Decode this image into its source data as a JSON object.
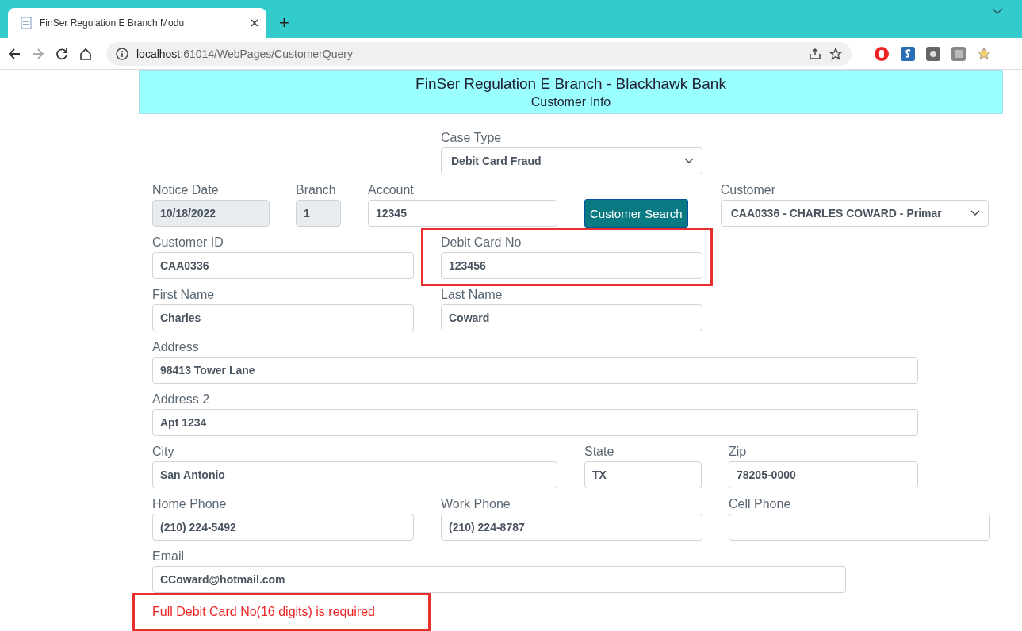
{
  "browser": {
    "tab_title": "FinSer Regulation E Branch Modu",
    "new_tab": "+",
    "url_host": "localhost",
    "url_path": ":61014/WebPages/CustomerQuery"
  },
  "header": {
    "title": "FinSer Regulation E Branch - Blackhawk Bank",
    "subtitle": "Customer Info"
  },
  "form": {
    "fields": [
      {
        "kind": "select",
        "label": "Case Type",
        "value": "Debit Card Fraud"
      },
      {
        "kind": "input",
        "label": "Notice Date",
        "value": "10/18/2022",
        "disabled": true
      },
      {
        "kind": "input",
        "label": "Branch",
        "value": "1",
        "disabled": true
      },
      {
        "kind": "input",
        "label": "Account",
        "value": "12345",
        "disabled": false
      },
      {
        "kind": "button",
        "label": "Customer Search"
      },
      {
        "kind": "select",
        "label": "Customer",
        "value": "CAA0336 - CHARLES COWARD - Primar"
      },
      {
        "kind": "input",
        "label": "Customer ID",
        "value": "CAA0336",
        "disabled": false
      },
      {
        "kind": "input",
        "label": "Debit Card No",
        "value": "123456",
        "disabled": false,
        "highlighted": true
      },
      {
        "kind": "input",
        "label": "First Name",
        "value": "Charles",
        "disabled": false
      },
      {
        "kind": "input",
        "label": "Last Name",
        "value": "Coward",
        "disabled": false
      },
      {
        "kind": "input",
        "label": "Address",
        "value": "98413 Tower Lane",
        "disabled": false
      },
      {
        "kind": "input",
        "label": "Address 2",
        "value": "Apt 1234",
        "disabled": false
      },
      {
        "kind": "input",
        "label": "City",
        "value": "San Antonio",
        "disabled": false
      },
      {
        "kind": "input",
        "label": "State",
        "value": "TX",
        "disabled": false
      },
      {
        "kind": "input",
        "label": "Zip",
        "value": "78205-0000",
        "disabled": false
      },
      {
        "kind": "input",
        "label": "Home Phone",
        "value": "(210) 224-5492",
        "disabled": false
      },
      {
        "kind": "input",
        "label": "Work Phone",
        "value": "(210) 224-8787",
        "disabled": false
      },
      {
        "kind": "input",
        "label": "Cell Phone",
        "disabled": false
      },
      {
        "kind": "input",
        "label": "Email",
        "value": "CCoward@hotmail.com",
        "disabled": false
      }
    ]
  },
  "error": {
    "text": "Full Debit Card No(16 digits) is required",
    "highlighted": true
  }
}
